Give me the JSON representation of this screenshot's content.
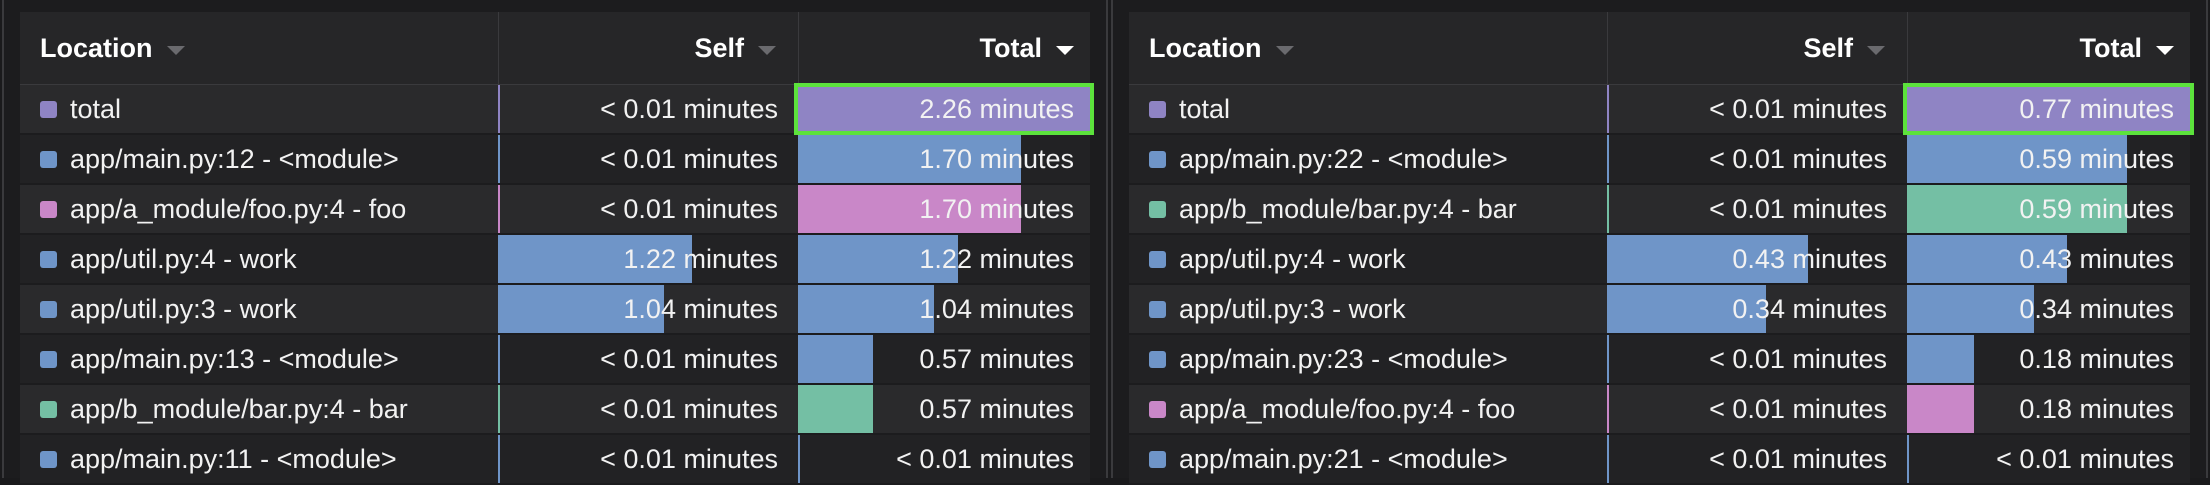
{
  "columns": {
    "location": "Location",
    "self": "Self",
    "total": "Total",
    "sorted_by": "total"
  },
  "colors": {
    "blue": "#6f95c8",
    "purple": "#8f84c4",
    "pink": "#c987c8",
    "green": "#74bfa4",
    "highlight": "#5ce23c"
  },
  "panels": [
    {
      "highlighted_row": 0,
      "max_total": 2.26,
      "rows": [
        {
          "location": "total",
          "color": "purple",
          "self": "< 0.01 minutes",
          "self_value": 0.0,
          "total": "2.26 minutes",
          "total_value": 2.26
        },
        {
          "location": "app/main.py:12 - <module>",
          "color": "blue",
          "self": "< 0.01 minutes",
          "self_value": 0.0,
          "total": "1.70 minutes",
          "total_value": 1.7
        },
        {
          "location": "app/a_module/foo.py:4 - foo",
          "color": "pink",
          "self": "< 0.01 minutes",
          "self_value": 0.0,
          "total": "1.70 minutes",
          "total_value": 1.7
        },
        {
          "location": "app/util.py:4 - work",
          "color": "blue",
          "self": "1.22 minutes",
          "self_value": 1.22,
          "total": "1.22 minutes",
          "total_value": 1.22
        },
        {
          "location": "app/util.py:3 - work",
          "color": "blue",
          "self": "1.04 minutes",
          "self_value": 1.04,
          "total": "1.04 minutes",
          "total_value": 1.04
        },
        {
          "location": "app/main.py:13 - <module>",
          "color": "blue",
          "self": "< 0.01 minutes",
          "self_value": 0.0,
          "total": "0.57 minutes",
          "total_value": 0.57
        },
        {
          "location": "app/b_module/bar.py:4 - bar",
          "color": "green",
          "self": "< 0.01 minutes",
          "self_value": 0.0,
          "total": "0.57 minutes",
          "total_value": 0.57
        },
        {
          "location": "app/main.py:11 - <module>",
          "color": "blue",
          "self": "< 0.01 minutes",
          "self_value": 0.0,
          "total": "< 0.01 minutes",
          "total_value": 0.0
        }
      ]
    },
    {
      "highlighted_row": 0,
      "max_total": 0.77,
      "rows": [
        {
          "location": "total",
          "color": "purple",
          "self": "< 0.01 minutes",
          "self_value": 0.0,
          "total": "0.77 minutes",
          "total_value": 0.77
        },
        {
          "location": "app/main.py:22 - <module>",
          "color": "blue",
          "self": "< 0.01 minutes",
          "self_value": 0.0,
          "total": "0.59 minutes",
          "total_value": 0.59
        },
        {
          "location": "app/b_module/bar.py:4 - bar",
          "color": "green",
          "self": "< 0.01 minutes",
          "self_value": 0.0,
          "total": "0.59 minutes",
          "total_value": 0.59
        },
        {
          "location": "app/util.py:4 - work",
          "color": "blue",
          "self": "0.43 minutes",
          "self_value": 0.43,
          "total": "0.43 minutes",
          "total_value": 0.43
        },
        {
          "location": "app/util.py:3 - work",
          "color": "blue",
          "self": "0.34 minutes",
          "self_value": 0.34,
          "total": "0.34 minutes",
          "total_value": 0.34
        },
        {
          "location": "app/main.py:23 - <module>",
          "color": "blue",
          "self": "< 0.01 minutes",
          "self_value": 0.0,
          "total": "0.18 minutes",
          "total_value": 0.18
        },
        {
          "location": "app/a_module/foo.py:4 - foo",
          "color": "pink",
          "self": "< 0.01 minutes",
          "self_value": 0.0,
          "total": "0.18 minutes",
          "total_value": 0.18
        },
        {
          "location": "app/main.py:21 - <module>",
          "color": "blue",
          "self": "< 0.01 minutes",
          "self_value": 0.0,
          "total": "< 0.01 minutes",
          "total_value": 0.0
        }
      ]
    }
  ]
}
